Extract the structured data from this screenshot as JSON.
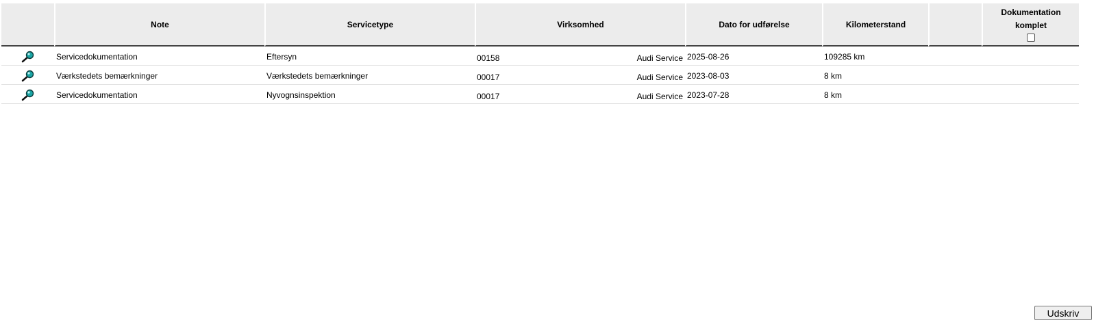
{
  "table": {
    "headers": {
      "icon": "",
      "note": "Note",
      "servicetype": "Servicetype",
      "virksomhed": "Virksomhed",
      "dato": "Dato for udførelse",
      "kilometer": "Kilometerstand",
      "extra": "",
      "dokumentation": "Dokumentation komplet"
    },
    "rows": [
      {
        "note": "Servicedokumentation",
        "servicetype": "Eftersyn",
        "virksomhed_code": "00158",
        "virksomhed_name": "Audi Service",
        "dato": "2025-08-26",
        "kilometer": "109285 km",
        "icon": "magnifier-icon"
      },
      {
        "note": "Værkstedets bemærkninger",
        "servicetype": "Værkstedets bemærkninger",
        "virksomhed_code": "00017",
        "virksomhed_name": "Audi Service",
        "dato": "2023-08-03",
        "kilometer": "8 km",
        "icon": "magnifier-icon"
      },
      {
        "note": "Servicedokumentation",
        "servicetype": "Nyvognsinspektion",
        "virksomhed_code": "00017",
        "virksomhed_name": "Audi Service",
        "dato": "2023-07-28",
        "kilometer": "8 km",
        "icon": "magnifier-icon"
      }
    ]
  },
  "actions": {
    "print_label": "Udskriv"
  },
  "colors": {
    "header_bg": "#ececec",
    "header_rule": "#444444",
    "icon_lens": "#1aa5a5"
  }
}
